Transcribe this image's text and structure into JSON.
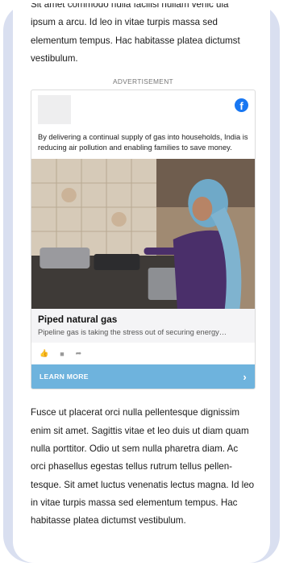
{
  "article": {
    "para_top": "Sit amet commodo nulla facilisi nullam venic ula ipsum a arcu. Id leo in vitae turpis massa sed elementum tempus. Hac habitasse platea dictumst vestibulum.",
    "para_bottom": "Fusce ut placerat orci nulla pellentesque dignissim enim sit amet. Sagittis vitae et leo duis ut diam quam nulla porttitor. Odio ut sem nulla pharetra diam. Ac orci phasellus egestas tellus rutrum tellus pellen-tesque. Sit amet luctus venenatis lectus magna. Id leo in vitae turpis massa sed elementum tempus. Hac habitasse platea dictumst vestibulum."
  },
  "ad": {
    "label": "ADVERTISEMENT",
    "platform_icon": "facebook-icon",
    "body_text": "By delivering a continual supply of gas into households, India is reducing air pollution and enabling families to save money.",
    "title": "Piped natural gas",
    "subtitle": "Pipeline gas is taking the stress out of securing energy…",
    "actions": [
      "like-icon",
      "comment-icon",
      "share-icon"
    ],
    "cta_label": "LEARN MORE",
    "cta_color": "#6eb3dd",
    "facebook_color": "#1877f2"
  },
  "frame_color": "#d9dff0"
}
